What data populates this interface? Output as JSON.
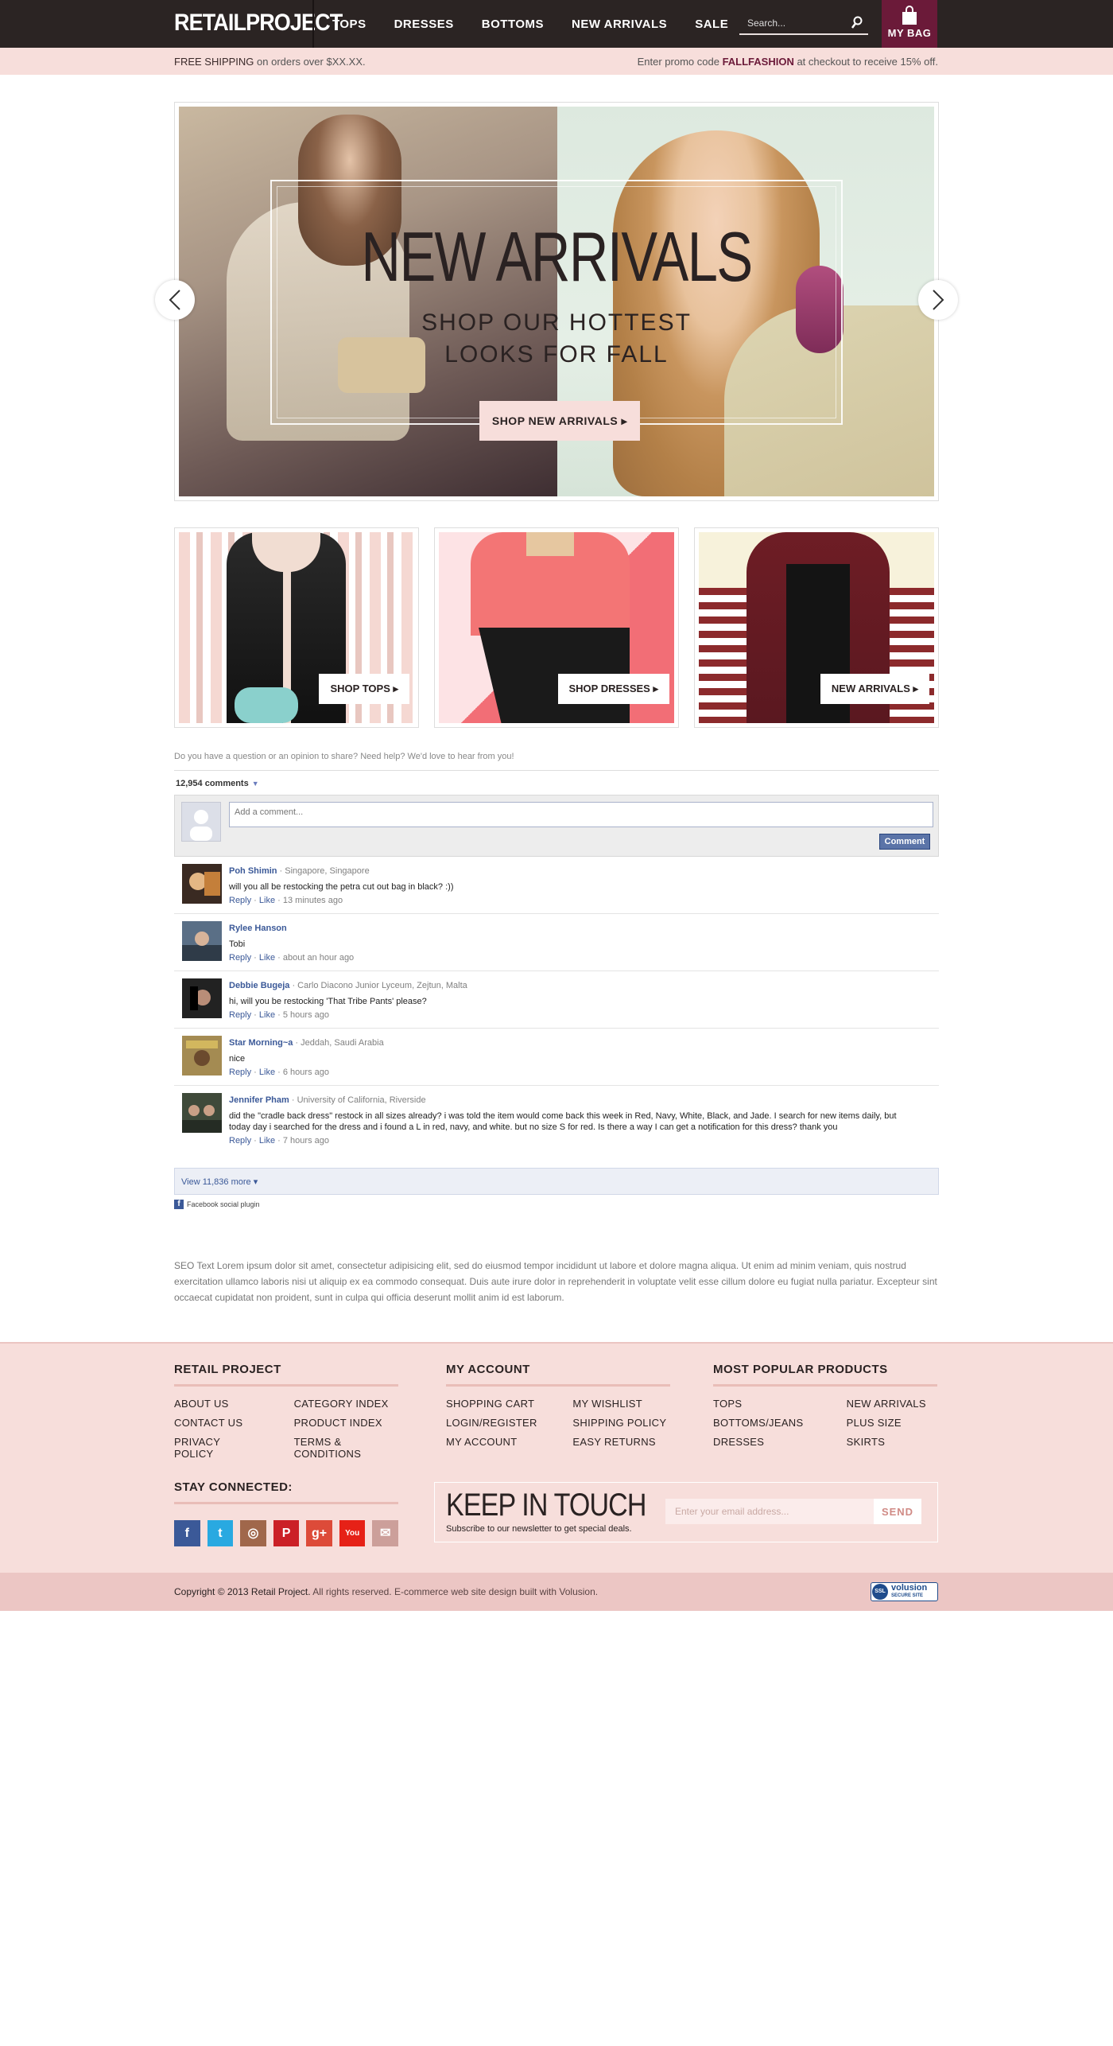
{
  "header": {
    "logo": "RETAILPROJECT",
    "nav": [
      "TOPS",
      "DRESSES",
      "BOTTOMS",
      "NEW ARRIVALS",
      "SALE"
    ],
    "search_placeholder": "Search...",
    "bag_label": "MY BAG"
  },
  "promo": {
    "left_strong": "FREE SHIPPING",
    "left_rest": " on orders over $XX.XX.",
    "right_pre": "Enter promo code ",
    "right_code": "FALLFASHION",
    "right_post": " at checkout to receive 15% off."
  },
  "hero": {
    "title": "NEW ARRIVALS",
    "subtitle_line1": "SHOP OUR HOTTEST",
    "subtitle_line2": "LOOKS FOR FALL",
    "button": "SHOP NEW ARRIVALS ▸"
  },
  "tiles": [
    {
      "label": "SHOP TOPS ▸"
    },
    {
      "label": "SHOP DRESSES ▸"
    },
    {
      "label": "NEW ARRIVALS ▸"
    }
  ],
  "comments": {
    "intro": "Do you have a question or an opinion to share? Need help? We'd love to hear from you!",
    "count": "12,954 comments",
    "placeholder": "Add a comment...",
    "submit": "Comment",
    "items": [
      {
        "name": "Poh Shimin",
        "meta": " · Singapore, Singapore",
        "text": "will you all be restocking the petra cut out bag in black? :))",
        "time": "13 minutes ago"
      },
      {
        "name": "Rylee Hanson",
        "meta": "",
        "text": "Tobi",
        "time": "about an hour ago"
      },
      {
        "name": "Debbie Bugeja",
        "meta": " · Carlo Diacono Junior Lyceum, Zejtun, Malta",
        "text": "hi, will you be restocking 'That Tribe Pants' please?",
        "time": "5 hours ago"
      },
      {
        "name": "Star Morning~a",
        "meta": " · Jeddah, Saudi Arabia",
        "text": "nice",
        "time": "6 hours ago"
      },
      {
        "name": "Jennifer Pham",
        "meta": " · University of California, Riverside",
        "text": "did the \"cradle back dress\" restock in all sizes already? i was told the item would come back this week in Red, Navy, White, Black, and Jade. I search for new items daily, but today day i searched for the dress and i found a L in red, navy, and white. but no size S for red. Is there a way I can get a notification for this dress? thank you",
        "time": "7 hours ago"
      }
    ],
    "reply": "Reply",
    "like": "Like",
    "sep": " · ",
    "view_more": "View 11,836 more ▾",
    "plugin": "Facebook social plugin"
  },
  "seo_text": "SEO Text Lorem ipsum dolor sit amet, consectetur adipisicing elit, sed do eiusmod tempor incididunt ut labore et dolore magna aliqua. Ut enim ad minim veniam, quis nostrud exercitation ullamco laboris nisi ut aliquip ex ea commodo consequat. Duis aute irure dolor in reprehenderit in voluptate velit esse cillum dolore eu fugiat nulla pariatur. Excepteur sint occaecat cupidatat non proident, sunt in culpa qui officia deserunt mollit anim id est laborum.",
  "footer": {
    "retail": {
      "title": "RETAIL PROJECT",
      "links": [
        "ABOUT US",
        "CATEGORY INDEX",
        "CONTACT US",
        "PRODUCT INDEX",
        "PRIVACY POLICY",
        "TERMS & CONDITIONS"
      ]
    },
    "account": {
      "title": "MY ACCOUNT",
      "links": [
        "SHOPPING CART",
        "MY WISHLIST",
        "LOGIN/REGISTER",
        "SHIPPING POLICY",
        "MY ACCOUNT",
        "EASY RETURNS"
      ]
    },
    "popular": {
      "title": "MOST POPULAR PRODUCTS",
      "links": [
        "TOPS",
        "NEW ARRIVALS",
        "BOTTOMS/JEANS",
        "PLUS SIZE",
        "DRESSES",
        "SKIRTS"
      ]
    },
    "stay_title": "STAY CONNECTED:",
    "socials": [
      {
        "name": "facebook",
        "glyph": "f",
        "color": "#3b5998"
      },
      {
        "name": "twitter",
        "glyph": "t",
        "color": "#29a9e1"
      },
      {
        "name": "instagram",
        "glyph": "◎",
        "color": "#a0674b"
      },
      {
        "name": "pinterest",
        "glyph": "P",
        "color": "#cb2027"
      },
      {
        "name": "google-plus",
        "glyph": "g+",
        "color": "#dd4b39"
      },
      {
        "name": "youtube",
        "glyph": "You",
        "color": "#e62117"
      },
      {
        "name": "email",
        "glyph": "✉",
        "color": "#cc9f9a"
      }
    ],
    "newsletter_title": "KEEP IN TOUCH",
    "newsletter_sub": "Subscribe to our newsletter to get special deals.",
    "newsletter_placeholder": "Enter your email address...",
    "newsletter_button": "SEND"
  },
  "copyright": {
    "bold": "Copyright © 2013 Retail Project.",
    "rest": " All rights reserved. E-commerce web site design built with Volusion.",
    "ssl_badge": "SSL",
    "ssl_brand": "volusion",
    "ssl_sub": "SECURE SITE"
  },
  "colors": {
    "header_bg": "#2b2423",
    "accent": "#6b1a39",
    "pink": "#f7dedb",
    "fb_blue": "#3b5998"
  }
}
